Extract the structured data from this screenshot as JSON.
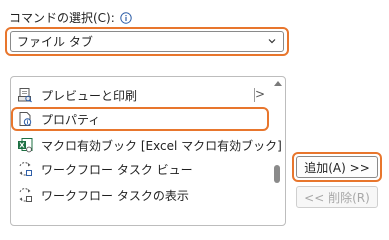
{
  "command_select": {
    "label": "コマンドの選択(C):",
    "selected": "ファイル タブ"
  },
  "list": {
    "items": [
      {
        "label": "プレビューと印刷",
        "icon": "print-preview-icon",
        "has_submenu": true
      },
      {
        "label": "プロパティ",
        "icon": "properties-icon",
        "has_submenu": false
      },
      {
        "label": "マクロ有効ブック [Excel マクロ有効ブック]",
        "icon": "excel-macro-workbook-icon",
        "has_submenu": false
      },
      {
        "label": "ワークフロー タスク ビュー",
        "icon": "workflow-task-view-icon",
        "has_submenu": false
      },
      {
        "label": "ワークフロー タスクの表示",
        "icon": "workflow-task-display-icon",
        "has_submenu": false
      }
    ],
    "submenu_glyph": ">"
  },
  "buttons": {
    "add": "追加(A) >>",
    "remove": "<< 削除(R)"
  },
  "colors": {
    "highlight": "#e8762d",
    "excel_green": "#1d6f42",
    "disabled_text": "#a8a8a8"
  }
}
